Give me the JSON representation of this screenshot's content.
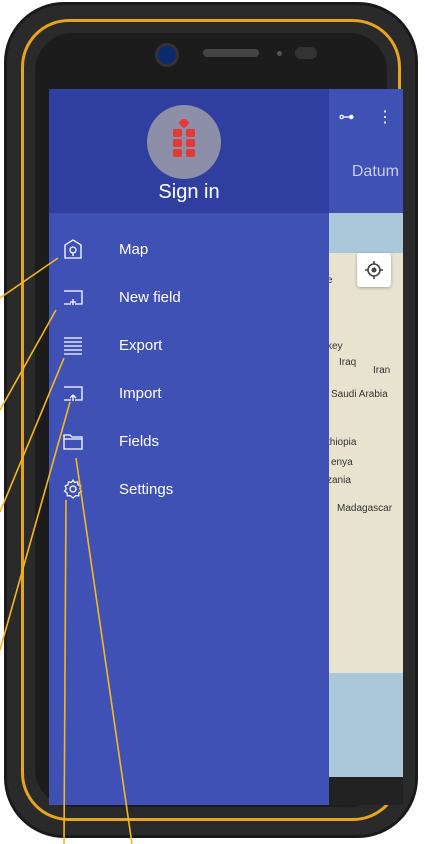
{
  "app": {
    "tab_label": "Datum",
    "signin_label": "Sign in",
    "brand_color": "#e53935",
    "drawer_color": "#3f51b5"
  },
  "menu": {
    "items": [
      {
        "label": "Map",
        "icon": "map-pin-icon"
      },
      {
        "label": "New field",
        "icon": "new-field-icon"
      },
      {
        "label": "Export",
        "icon": "export-icon"
      },
      {
        "label": "Import",
        "icon": "import-icon"
      },
      {
        "label": "Fields",
        "icon": "folder-icon"
      },
      {
        "label": "Settings",
        "icon": "gear-icon"
      }
    ]
  },
  "map": {
    "labels": [
      "Iraq",
      "Iran",
      "Saudi Arabia",
      "thiopia",
      "enya",
      "zania",
      "Madagascar",
      "key",
      "e"
    ]
  }
}
